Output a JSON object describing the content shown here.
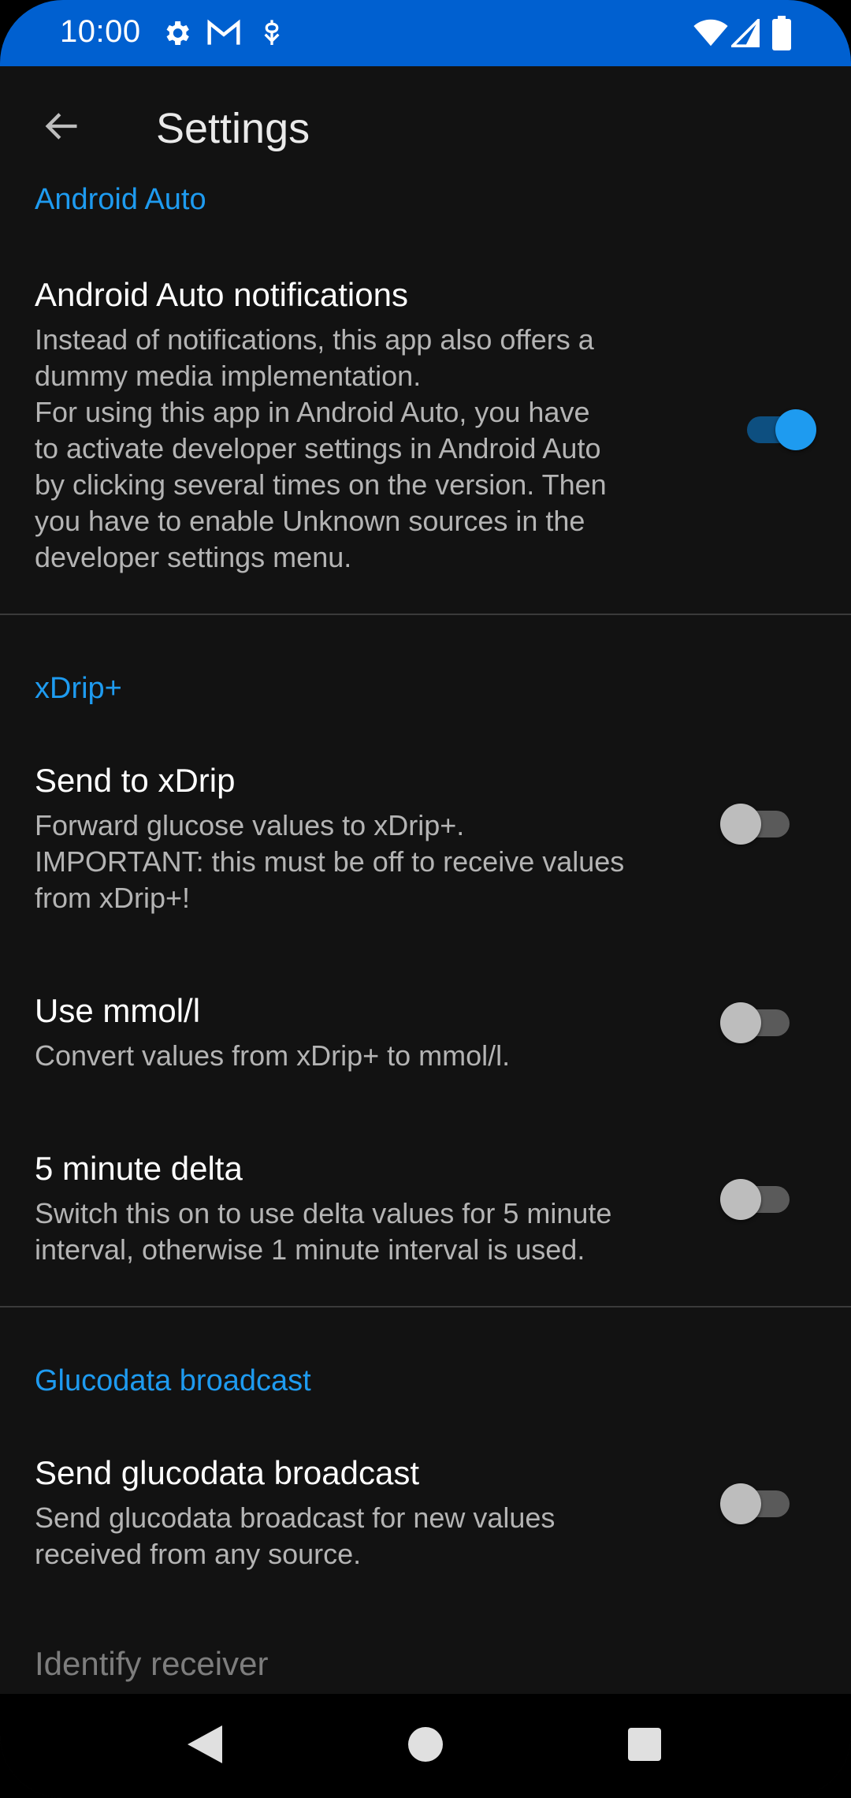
{
  "status_bar": {
    "time": "10:00",
    "left_icons": [
      "gear-icon",
      "gmail-icon",
      "usb-debug-icon"
    ],
    "right_icons": [
      "wifi-icon",
      "cellular-signal-icon",
      "battery-icon"
    ],
    "background": "#0060d0"
  },
  "app_bar": {
    "title": "Settings",
    "back_icon": "arrow-back-icon"
  },
  "colors": {
    "accent": "#1e9bf0",
    "background": "#121212",
    "switch_on_track": "#0d4f80",
    "switch_off_thumb": "#bdbdbd"
  },
  "sections": [
    {
      "category": "Android Auto",
      "prefs": [
        {
          "title": "Android Auto notifications",
          "summary": "Instead of notifications, this app also offers a\ndummy media implementation.\nFor using this app in Android Auto, you have\nto activate developer settings in Android Auto\nby clicking several times on the version. Then\nyou have to enable Unknown sources in the\ndeveloper settings menu.",
          "enabled": true
        }
      ]
    },
    {
      "category": "xDrip+",
      "prefs": [
        {
          "title": "Send to xDrip",
          "summary": "Forward glucose values to xDrip+.\nIMPORTANT: this must be off to receive values\nfrom xDrip+!",
          "enabled": false
        },
        {
          "title": "Use mmol/l",
          "summary": "Convert values from xDrip+ to mmol/l.",
          "enabled": false
        },
        {
          "title": "5 minute delta",
          "summary": "Switch this on to use delta values for 5 minute\ninterval, otherwise 1 minute interval is used.",
          "enabled": false
        }
      ]
    },
    {
      "category": "Glucodata broadcast",
      "prefs": [
        {
          "title": "Send glucodata broadcast",
          "summary": "Send glucodata broadcast for new values\nreceived from any source.",
          "enabled": false
        },
        {
          "title": "Identify receiver",
          "summary": ""
        }
      ]
    }
  ],
  "nav_bar": {
    "buttons": [
      "back-triangle-icon",
      "home-circle-icon",
      "recents-square-icon"
    ]
  }
}
